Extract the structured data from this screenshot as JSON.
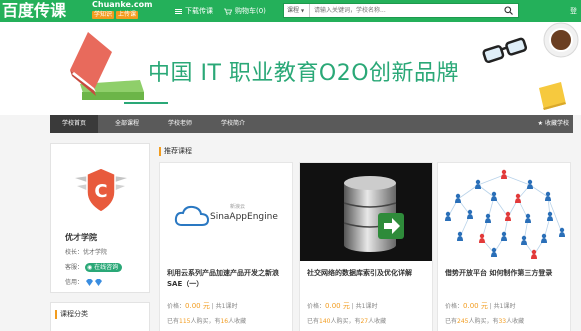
{
  "header": {
    "logo_cn": "百度传课",
    "logo_en": "Chuanke.com",
    "logo_tags": [
      "学知识",
      "上传课"
    ],
    "download_label": "下载传课",
    "cart_label": "购物车(0)",
    "search_category": "课程",
    "search_placeholder": "请输入关键词，学校名称..."
  },
  "banner": {
    "title": "中国 IT 职业教育O2O创新品牌"
  },
  "nav": {
    "items": [
      "学校首页",
      "全部课程",
      "学校老师",
      "学校简介"
    ],
    "collect_label": "收藏学校"
  },
  "school": {
    "logo_letter": "C",
    "name": "优才学院",
    "owner_label": "校长：",
    "owner_value": "优才学院",
    "consult_label": "客服：",
    "consult_btn": "在线咨询",
    "credit_label": "信用："
  },
  "category": {
    "title": "课程分类"
  },
  "recommend": {
    "title": "推荐课程",
    "courses": [
      {
        "title": "利用云系列产品加速产品开发之新浪SAE（一）",
        "price_label": "价格：",
        "price": "0.00 元",
        "hours": "| 共1课时",
        "stats_prefix": "已有",
        "buyers": "115",
        "stats_mid": "人购买，有",
        "favs": "16",
        "stats_suffix": "人收藏",
        "thumb_text": "SinaAppEngine"
      },
      {
        "title": "社交网络的数据库索引及优化详解",
        "price_label": "价格：",
        "price": "0.00 元",
        "hours": "| 共1课时",
        "stats_prefix": "已有",
        "buyers": "140",
        "stats_mid": "人购买，有",
        "favs": "27",
        "stats_suffix": "人收藏"
      },
      {
        "title": "借势开放平台 如何制作第三方登录",
        "price_label": "价格：",
        "price": "0.00 元",
        "hours": "| 共1课时",
        "stats_prefix": "已有",
        "buyers": "245",
        "stats_mid": "人购买，有",
        "favs": "33",
        "stats_suffix": "人收藏"
      }
    ]
  },
  "colors": {
    "brand_green": "#24b05a",
    "accent_orange": "#f29c1f",
    "nav_gray": "#5a5a5a"
  }
}
